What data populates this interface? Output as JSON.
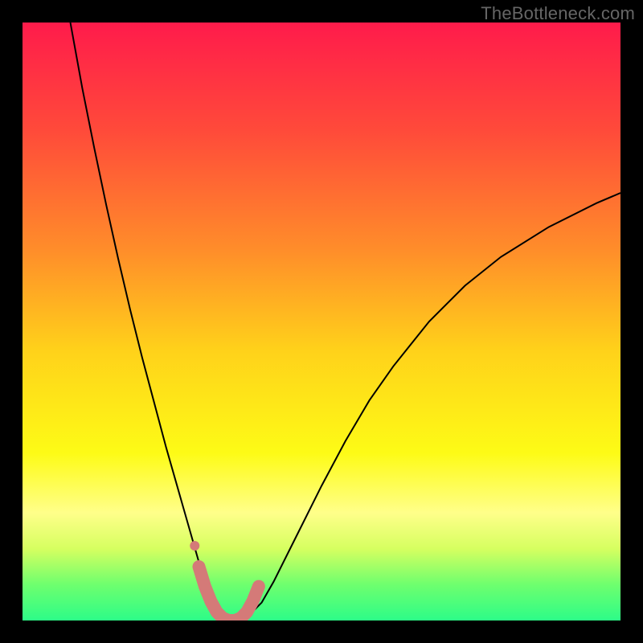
{
  "watermark": "TheBottleneck.com",
  "chart_data": {
    "type": "line",
    "title": "",
    "xlabel": "",
    "ylabel": "",
    "xlim": [
      0,
      100
    ],
    "ylim": [
      0,
      100
    ],
    "grid": false,
    "legend": false,
    "background_gradient": {
      "stops": [
        {
          "offset": 0.0,
          "color": "#ff1b4b"
        },
        {
          "offset": 0.18,
          "color": "#ff4a3a"
        },
        {
          "offset": 0.38,
          "color": "#ff8d2a"
        },
        {
          "offset": 0.55,
          "color": "#ffd21a"
        },
        {
          "offset": 0.72,
          "color": "#fdfb16"
        },
        {
          "offset": 0.82,
          "color": "#ffff8a"
        },
        {
          "offset": 0.88,
          "color": "#d6ff60"
        },
        {
          "offset": 0.94,
          "color": "#6eff6e"
        },
        {
          "offset": 1.0,
          "color": "#2dfc88"
        }
      ]
    },
    "series": [
      {
        "name": "main-curve",
        "color": "#000000",
        "stroke_width": 2,
        "x": [
          8,
          10,
          12,
          14,
          16,
          18,
          20,
          22,
          24,
          26,
          27,
          28,
          29,
          30,
          31,
          32,
          33,
          34,
          35,
          36,
          37,
          38,
          40,
          42,
          46,
          50,
          54,
          58,
          62,
          68,
          74,
          80,
          88,
          96,
          100
        ],
        "y": [
          100,
          89,
          79,
          69.5,
          60.5,
          52,
          44,
          36.5,
          29,
          22,
          18.5,
          15,
          11.5,
          8,
          5,
          2.5,
          1,
          0.3,
          0,
          0,
          0.3,
          1,
          3,
          6.5,
          14.5,
          22.5,
          30,
          36.8,
          42.5,
          50,
          56,
          60.8,
          65.8,
          69.8,
          71.5
        ]
      },
      {
        "name": "highlight-segment",
        "color": "#d47a78",
        "stroke_width": 16,
        "linecap": "round",
        "x": [
          29.5,
          30.5,
          31.5,
          32.5,
          33.5,
          34.5,
          35.5,
          36.5,
          37.5,
          38.5,
          39.5
        ],
        "y": [
          9.0,
          5.7,
          3.2,
          1.4,
          0.4,
          0.0,
          0.0,
          0.4,
          1.4,
          3.2,
          5.7
        ]
      }
    ],
    "markers": [
      {
        "name": "highlight-dot",
        "x": 28.8,
        "y": 12.5,
        "r": 6,
        "color": "#d47a78"
      }
    ]
  }
}
